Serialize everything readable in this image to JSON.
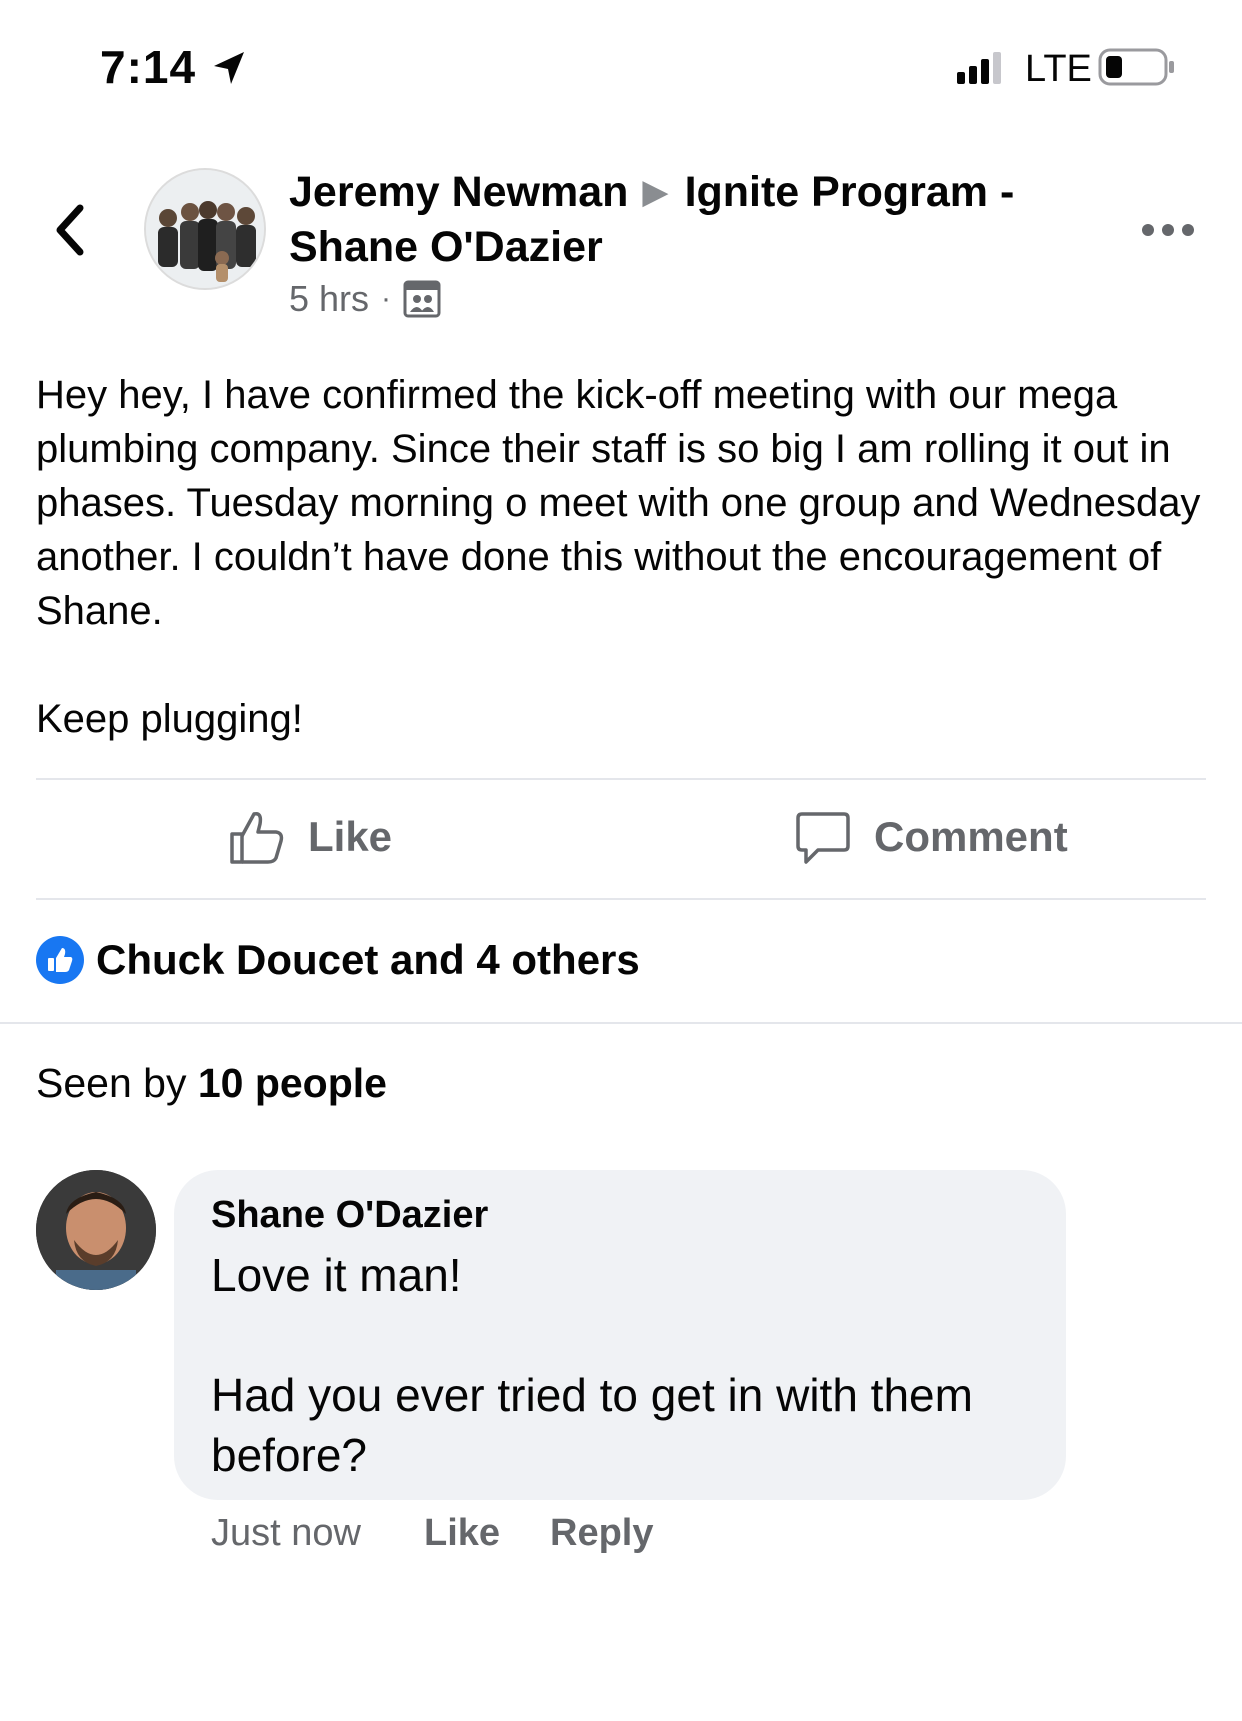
{
  "status_bar": {
    "time": "7:14",
    "carrier": "LTE",
    "icons": [
      "location-arrow-icon",
      "signal-icon",
      "battery-icon"
    ]
  },
  "header": {
    "author": "Jeremy Newman",
    "separator_icon": "triangle-right-icon",
    "group_line1": "Ignite Program -",
    "group_line2": "Shane O'Dazier",
    "timestamp": "5 hrs",
    "dot": "·",
    "audience_icon": "group-members-icon"
  },
  "post": {
    "text": "Hey hey, I have confirmed the kick-off meeting with our mega plumbing company. Since their staff is so big I am rolling it out in phases. Tuesday morning o meet with one group and Wednesday another. I couldn’t have done this without the encouragement of Shane.",
    "closing": "Keep plugging!"
  },
  "actions": {
    "like_label": "Like",
    "comment_label": "Comment"
  },
  "reactions": {
    "text": "Chuck Doucet and 4 others"
  },
  "seen": {
    "prefix": "Seen by ",
    "count_text": "10 people"
  },
  "comment": {
    "author": "Shane O'Dazier",
    "line1": "Love it man!",
    "line2": "Had you ever tried to get in with them before?",
    "time": "Just now",
    "like_label": "Like",
    "reply_label": "Reply"
  },
  "colors": {
    "accent": "#1877f2",
    "secondary_text": "#65676b",
    "bubble": "#f0f2f5"
  }
}
